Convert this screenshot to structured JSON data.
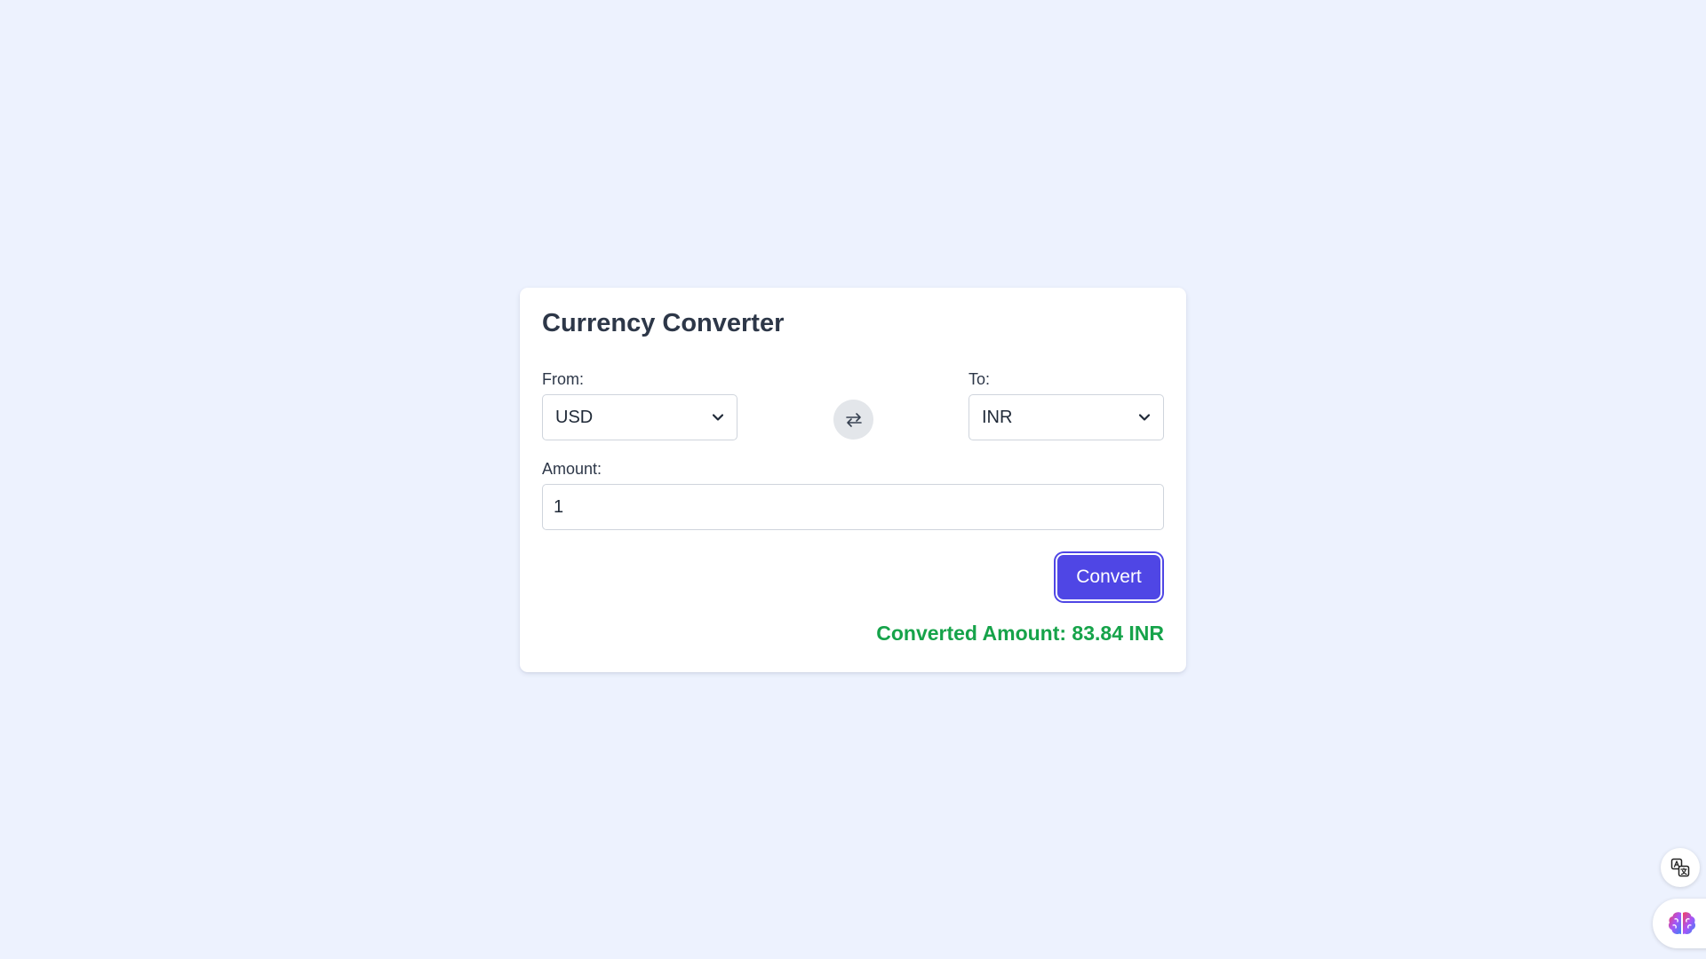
{
  "converter": {
    "title": "Currency Converter",
    "from": {
      "label": "From:",
      "selected": "USD"
    },
    "to": {
      "label": "To:",
      "selected": "INR"
    },
    "amount": {
      "label": "Amount:",
      "value": "1"
    },
    "convert_label": "Convert",
    "result_text": "Converted Amount: 83.84 INR"
  },
  "icons": {
    "swap": "swap-arrows-icon",
    "chevron": "chevron-down-icon",
    "translate": "translate-icon",
    "brain": "brain-icon"
  },
  "colors": {
    "background": "#edf2fe",
    "card": "#ffffff",
    "accent": "#4f46e5",
    "result": "#16a34a",
    "text": "#2d3748"
  }
}
